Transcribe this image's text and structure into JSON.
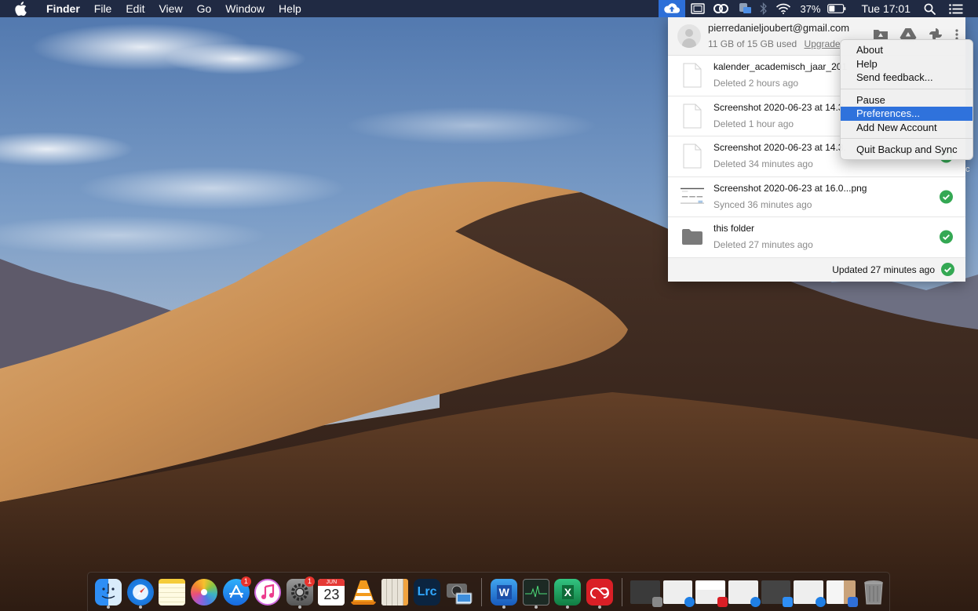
{
  "menubar": {
    "app_name": "Finder",
    "menus": [
      "File",
      "Edit",
      "View",
      "Go",
      "Window",
      "Help"
    ],
    "battery_percent": "37%",
    "clock": "Tue 17:01",
    "status_icons": [
      "backup-and-sync-icon",
      "display-icon",
      "creative-cloud-icon",
      "network-drive-icon",
      "bluetooth-icon",
      "wifi-icon",
      "battery-icon",
      "spotlight-icon",
      "notification-center-icon"
    ]
  },
  "panel": {
    "account_email": "pierredanieljoubert@gmail.com",
    "usage": "11 GB of 15 GB used",
    "upgrade_label": "Upgrade",
    "files": [
      {
        "name": "kalender_academisch_jaar_201",
        "status": "Deleted 2 hours ago",
        "thumb": "file",
        "synced": false
      },
      {
        "name": "Screenshot 2020-06-23 at 14.3.",
        "status": "Deleted 1 hour ago",
        "thumb": "file",
        "synced": false
      },
      {
        "name": "Screenshot 2020-06-23 at 14.3.",
        "status": "Deleted 34 minutes ago",
        "thumb": "file",
        "synced": true
      },
      {
        "name": "Screenshot 2020-06-23 at 16.0...png",
        "status": "Synced 36 minutes ago",
        "thumb": "screenshot",
        "synced": true
      },
      {
        "name": "this folder",
        "status": "Deleted 27 minutes ago",
        "thumb": "folder",
        "synced": true
      }
    ],
    "footer_status": "Updated 27 minutes ago"
  },
  "context_menu": {
    "items": [
      {
        "label": "About"
      },
      {
        "label": "Help"
      },
      {
        "label": "Send feedback..."
      },
      {
        "label": "Pause"
      },
      {
        "label": "Preferences...",
        "highlighted": true
      },
      {
        "label": "Add New Account"
      },
      {
        "label": "Quit Backup and Sync"
      }
    ]
  },
  "desktop": {
    "fragment_text": "c"
  },
  "dock": {
    "apps": [
      {
        "name": "Finder",
        "running": true
      },
      {
        "name": "Safari",
        "running": true
      },
      {
        "name": "Notes",
        "running": false
      },
      {
        "name": "Photos",
        "running": false
      },
      {
        "name": "App Store",
        "running": false,
        "badge": "1"
      },
      {
        "name": "iTunes",
        "running": false
      },
      {
        "name": "System Preferences",
        "running": true,
        "badge": "1"
      },
      {
        "name": "Calendar",
        "running": false,
        "month": "JUN",
        "day": "23"
      },
      {
        "name": "VLC",
        "running": false
      },
      {
        "name": "Numbers Sheet",
        "running": false
      },
      {
        "name": "Lightroom Classic",
        "running": false,
        "label": "Lrc"
      },
      {
        "name": "Image Capture",
        "running": false
      },
      {
        "name": "Microsoft Word",
        "running": true,
        "label": "W"
      },
      {
        "name": "Activity Monitor",
        "running": true
      },
      {
        "name": "Microsoft Excel",
        "running": true,
        "label": "X"
      },
      {
        "name": "Creative Cloud",
        "running": true
      }
    ],
    "minimized_windows": [
      "System Preferences window",
      "Safari window",
      "Creative Cloud window",
      "Safari window",
      "Finder window",
      "Safari window",
      "Preview window"
    ],
    "trash": "Trash"
  },
  "colors": {
    "menu_highlight": "#2f72dc",
    "sync_check": "#34a853",
    "menubar_active": "#2d6fd8"
  }
}
